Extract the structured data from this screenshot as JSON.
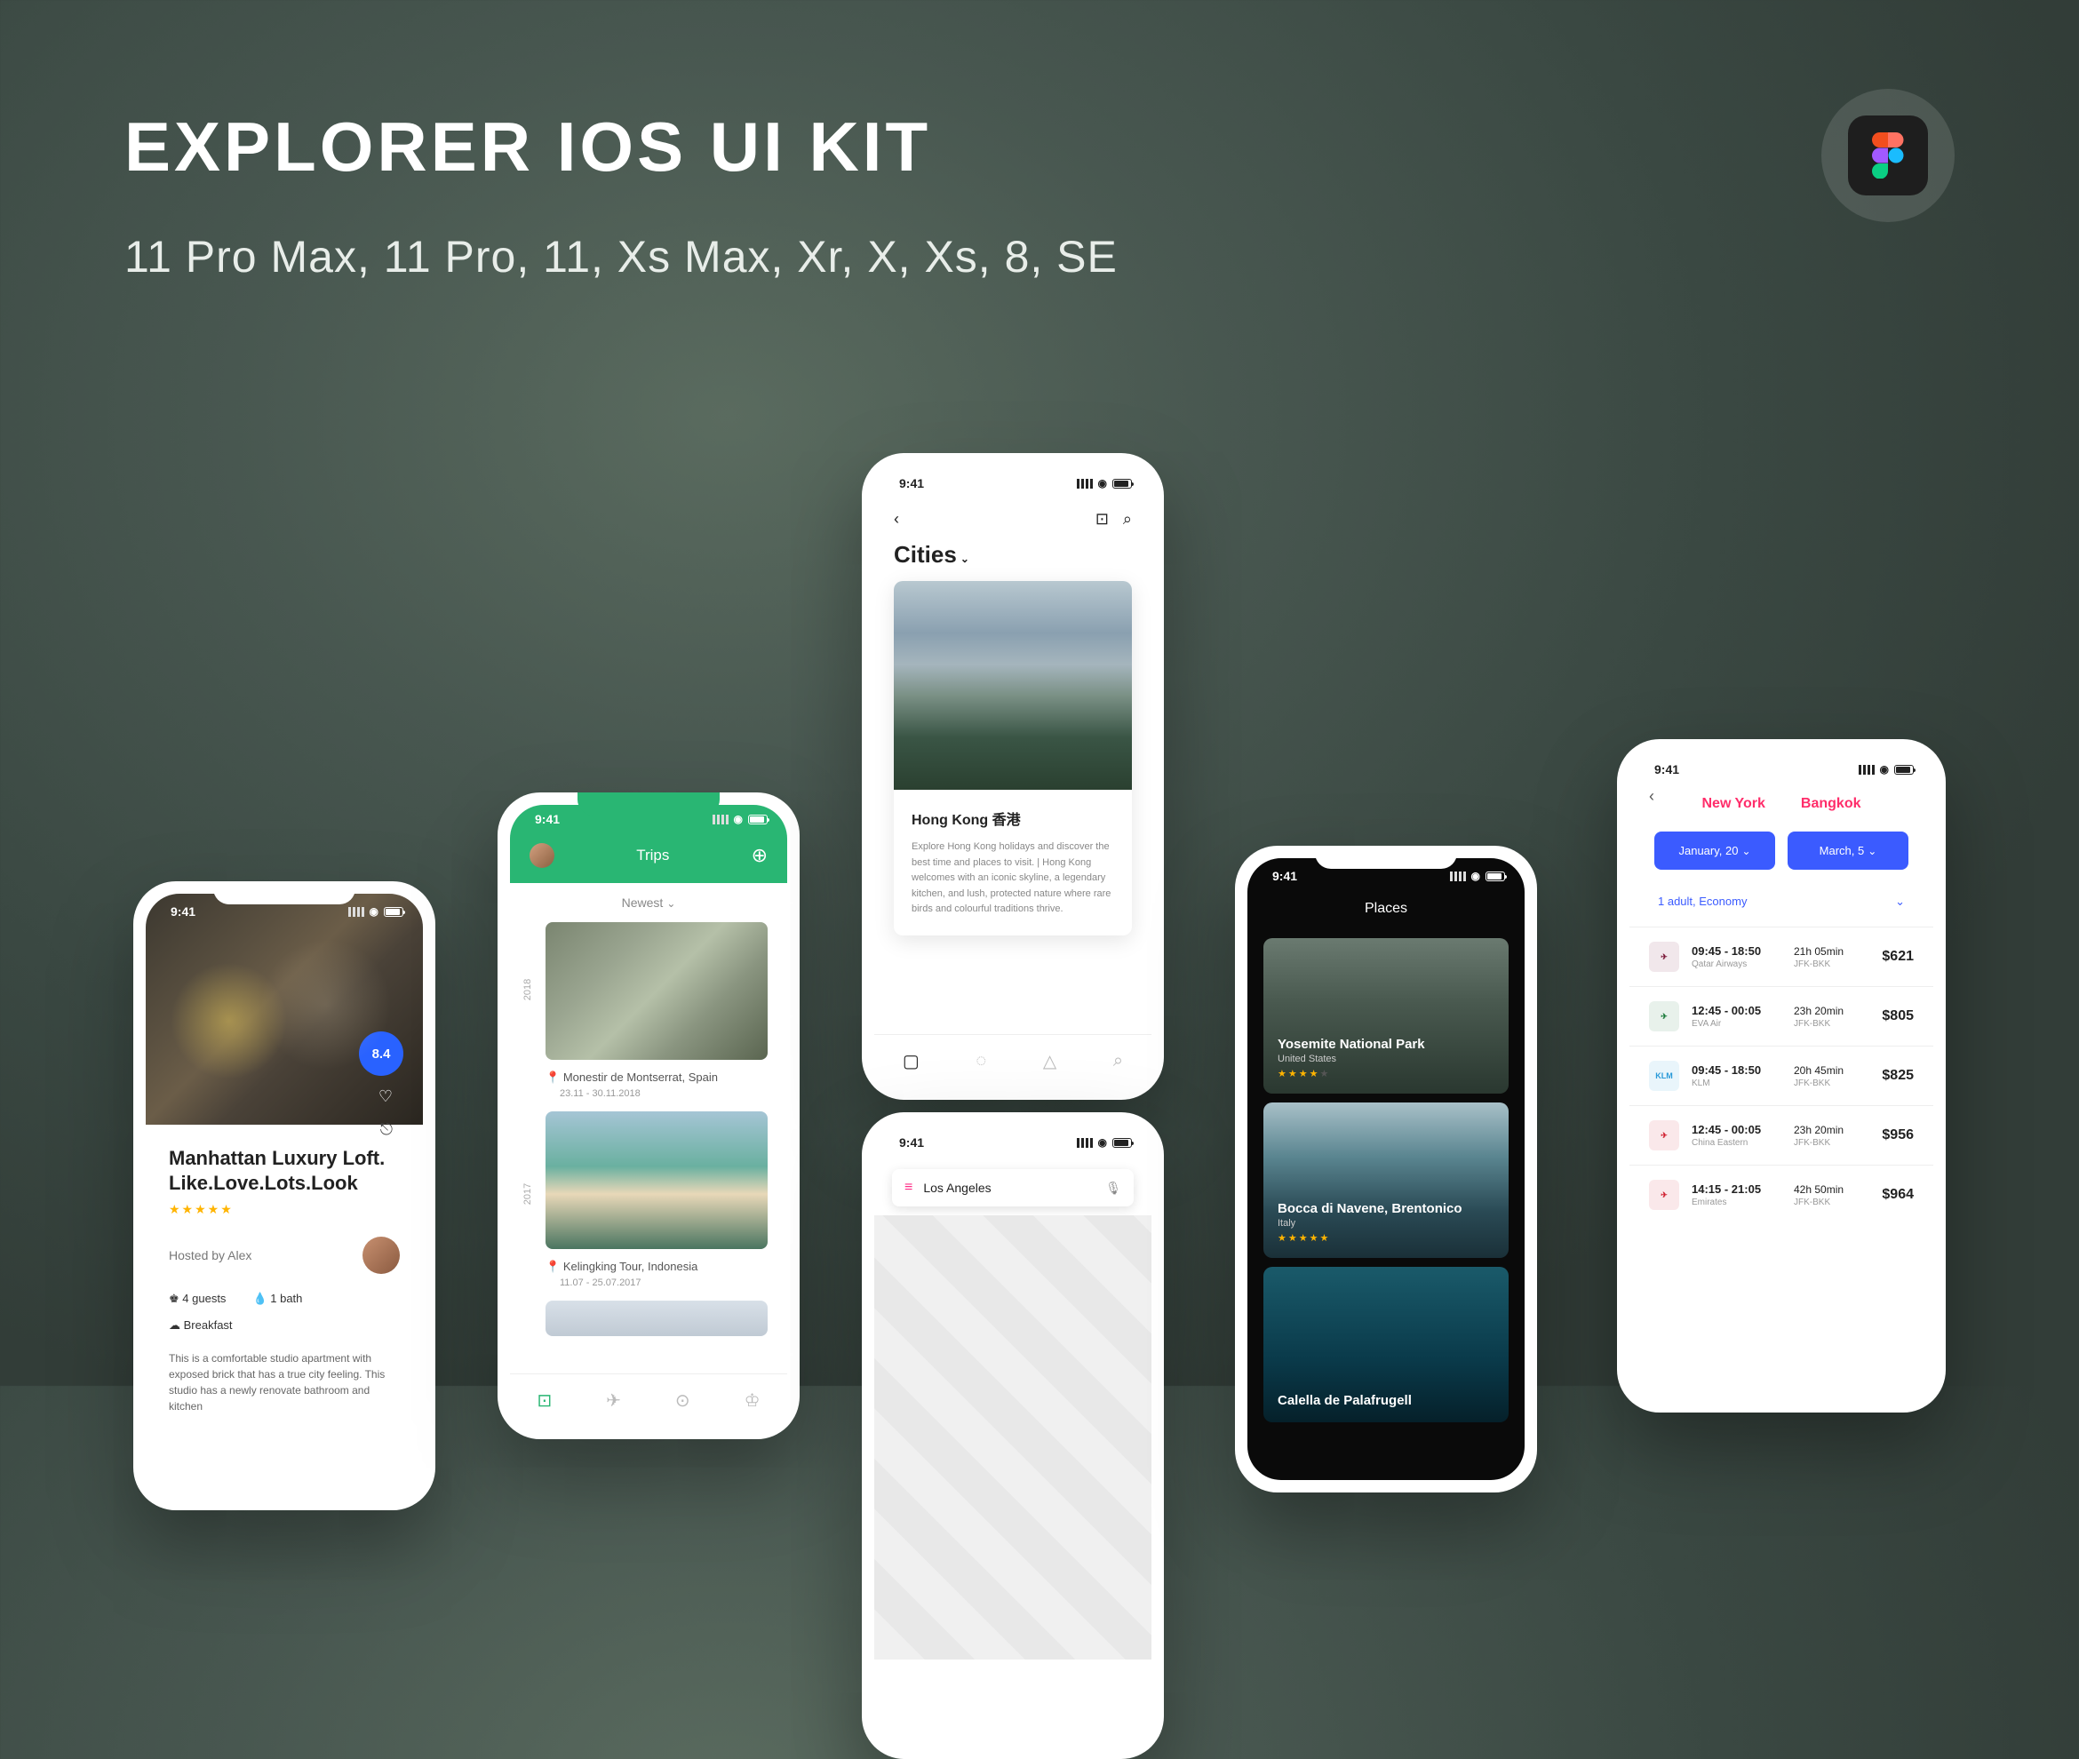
{
  "hero": {
    "title": "EXPLORER IOS UI KIT",
    "subtitle": "11 Pro Max, 11 Pro, 11, Xs Max, Xr, X, Xs, 8, SE"
  },
  "status_time": "9:41",
  "phone1_listing": {
    "rating": "8.4",
    "title": "Manhattan Luxury Loft. Like.Love.Lots.Look",
    "host": "Hosted by Alex",
    "guests": "4 guests",
    "bath": "1 bath",
    "breakfast": "Breakfast",
    "description": "This is a comfortable studio apartment with exposed brick that has a true city feeling. This studio has a newly renovate bathroom and kitchen"
  },
  "phone2_trips": {
    "header": "Trips",
    "sort": "Newest",
    "year1": "2018",
    "year2": "2017",
    "trip1_location": "Monestir de Montserrat, Spain",
    "trip1_dates": "23.11 - 30.11.2018",
    "trip2_location": "Kelingking Tour, Indonesia",
    "trip2_dates": "11.07 - 25.07.2017"
  },
  "phone3_cities": {
    "heading": "Cities",
    "card_title": "Hong Kong 香港",
    "card_desc": "Explore Hong Kong holidays and discover the best time and places to visit. | Hong Kong welcomes with an iconic skyline, a legendary kitchen, and lush, protected nature where rare birds and colourful traditions thrive."
  },
  "phone4_map": {
    "search": "Los Angeles"
  },
  "phone5_places": {
    "header": "Places",
    "p1_name": "Yosemite National Park",
    "p1_sub": "United States",
    "p2_name": "Bocca di Navene, Brentonico",
    "p2_sub": "Italy",
    "p3_name": "Calella de Palafrugell"
  },
  "phone6_flights": {
    "from": "New York",
    "to": "Bangkok",
    "date1": "January, 20",
    "date2": "March, 5",
    "pax": "1 adult, Economy",
    "flights": [
      {
        "time": "09:45 - 18:50",
        "airline": "Qatar Airways",
        "dur": "21h 05min",
        "route": "JFK-BKK",
        "price": "$621",
        "color": "#7a1838"
      },
      {
        "time": "12:45 - 00:05",
        "airline": "EVA Air",
        "dur": "23h 20min",
        "route": "JFK-BKK",
        "price": "$805",
        "color": "#1a7a3a"
      },
      {
        "time": "09:45 - 18:50",
        "airline": "KLM",
        "dur": "20h 45min",
        "route": "JFK-BKK",
        "price": "$825",
        "color": "#2a9ad8",
        "label": "KLM"
      },
      {
        "time": "12:45 - 00:05",
        "airline": "China Eastern",
        "dur": "23h 20min",
        "route": "JFK-BKK",
        "price": "$956",
        "color": "#d02030"
      },
      {
        "time": "14:15 - 21:05",
        "airline": "Emirates",
        "dur": "42h 50min",
        "route": "JFK-BKK",
        "price": "$964",
        "color": "#d02030"
      }
    ]
  }
}
